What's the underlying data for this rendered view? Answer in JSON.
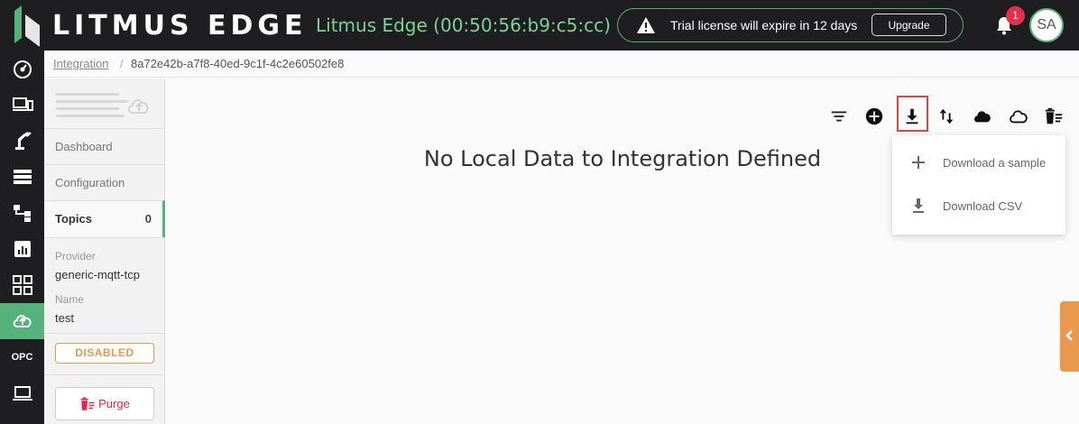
{
  "header": {
    "brand": "LITMUS EDGE",
    "device_title": "Litmus Edge (00:50:56:b9:c5:cc)",
    "trial_message": "Trial license will expire in 12 days",
    "upgrade_label": "Upgrade",
    "notification_count": "1",
    "user_initials": "SA"
  },
  "rail": {
    "items": [
      {
        "icon": "dashboard-icon"
      },
      {
        "icon": "devices-icon"
      },
      {
        "icon": "robot-arm-icon"
      },
      {
        "icon": "list-icon"
      },
      {
        "icon": "flow-icon"
      },
      {
        "icon": "analytics-icon"
      },
      {
        "icon": "apps-grid-icon"
      },
      {
        "icon": "cloud-upload-icon",
        "active": true
      },
      {
        "label": "OPC"
      },
      {
        "icon": "laptop-icon"
      }
    ]
  },
  "breadcrumb": {
    "root": "Integration",
    "separator": "/",
    "current": "8a72e42b-a7f8-40ed-9c1f-4c2e60502fe8"
  },
  "panel": {
    "nav": [
      {
        "label": "Dashboard"
      },
      {
        "label": "Configuration"
      },
      {
        "label": "Topics",
        "count": "0",
        "active": true
      }
    ],
    "provider_label": "Provider",
    "provider_value": "generic-mqtt-tcp",
    "name_label": "Name",
    "name_value": "test",
    "status": "DISABLED",
    "purge_label": "Purge"
  },
  "main": {
    "empty_message": "No Local Data to Integration Defined",
    "toolbar": [
      "filter-icon",
      "add-icon",
      "download-icon",
      "sort-icon",
      "cloud-filled-icon",
      "cloud-outline-icon",
      "delete-list-icon"
    ],
    "dropdown": [
      {
        "label": "Download a sample",
        "icon": "plus-icon"
      },
      {
        "label": "Download CSV",
        "icon": "download-icon"
      }
    ]
  },
  "colors": {
    "accent": "#56b27a",
    "warning": "#e8984f",
    "danger": "#e0274a",
    "header_bg": "#1e1e20"
  }
}
